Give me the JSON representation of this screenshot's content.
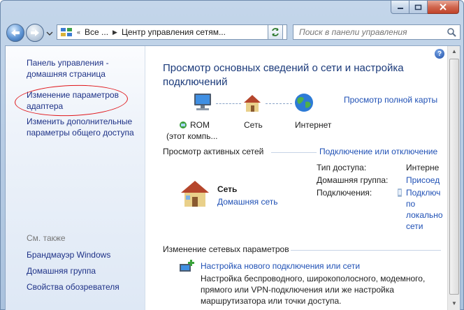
{
  "navigation": {
    "address_parts": [
      "Все ...",
      "Центр управления сетям..."
    ],
    "address_prefix": "«",
    "search_placeholder": "Поиск в панели управления"
  },
  "sidebar": {
    "home_link": "Панель управления - домашняя страница",
    "adapter_link": "Изменение параметров адаптера",
    "sharing_link": "Изменить дополнительные параметры общего доступа",
    "see_also": "См. также",
    "see_also_links": [
      "Брандмауэр Windows",
      "Домашняя группа",
      "Свойства обозревателя"
    ]
  },
  "main": {
    "title": "Просмотр основных сведений о сети и настройка подключений",
    "full_map_link": "Просмотр полной карты",
    "map": {
      "computer_name": "ROM",
      "computer_sub": "(этот компь...",
      "network": "Сеть",
      "internet": "Интернет"
    },
    "active_networks_label": "Просмотр активных сетей",
    "connect_link": "Подключение или отключение",
    "network_name": "Сеть",
    "network_type": "Домашняя сеть",
    "props": {
      "access_label": "Тип доступа:",
      "access_value": "Интерне",
      "homegroup_label": "Домашняя группа:",
      "homegroup_value": "Присоед",
      "connections_label": "Подключения:",
      "connections_value": [
        "Подключ",
        "по",
        "локально",
        "сети"
      ]
    },
    "change_settings_label": "Изменение сетевых параметров",
    "new_connection_link": "Настройка нового подключения или сети",
    "new_connection_desc": [
      "Настройка беспроводного, широкополосного, модемного,",
      "прямого или VPN-подключения или же настройка",
      "маршрутизатора или точки доступа."
    ]
  }
}
